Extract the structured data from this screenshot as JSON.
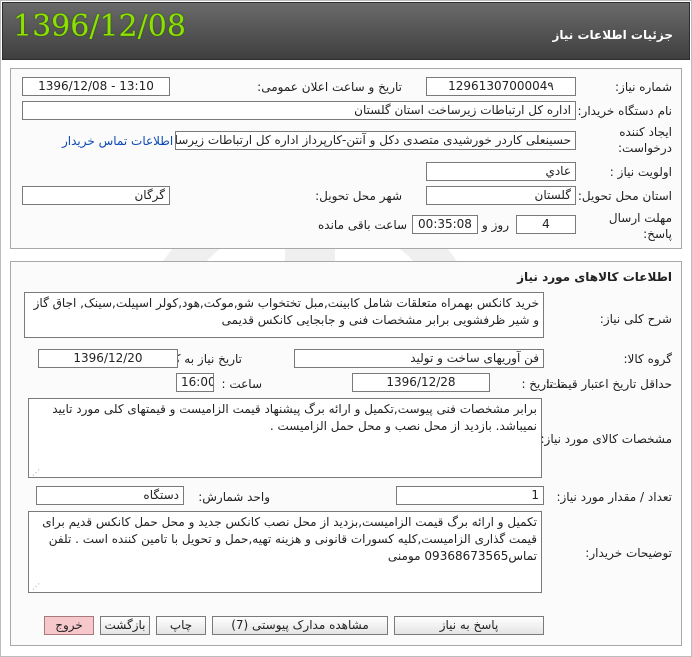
{
  "header": {
    "date": "1396/12/08",
    "title": "جزئیات اطلاعات نیاز"
  },
  "info": {
    "need_number_label": "شماره نیاز:",
    "need_number": "1296130700004۹",
    "announce_label": "تاریخ و ساعت اعلان عمومی:",
    "announce_value": "1396/12/08 - 13:10",
    "buyer_label": "نام دستگاه خریدار:",
    "buyer_value": "اداره کل ارتباطات زیرساخت استان گلستان",
    "creator_label": "ایجاد کننده درخواست:",
    "creator_value": "حسینعلی کاردر خورشیدی متصدی دکل و آنتن-کارپرداز اداره کل ارتباطات زیرساخ",
    "contact_link": "اطلاعات تماس خریدار",
    "priority_label": "اولویت نیاز :",
    "priority_value": "عادي",
    "province_label": "استان محل تحویل:",
    "province_value": "گلستان",
    "city_label": "شهر محل تحویل:",
    "city_value": "گرگان",
    "deadline_label": "مهلت ارسال پاسخ:",
    "deadline_days": "4",
    "days_label": "روز و",
    "deadline_time": "00:35:08",
    "remaining_label": "ساعت باقی مانده"
  },
  "goods": {
    "section_title": "اطلاعات کالاهای مورد نیاز",
    "general_desc_label": "شرح کلی نیاز:",
    "general_desc": "خرید کانکس بهمراه متعلقات شامل کابینت,مبل تختخواب شو,موکت,هود,کولر اسپیلت,سینک, اجاق گاز و شیر ظرفشویی برابر مشخصات فنی و جابجایی کانکس قدیمی",
    "group_label": "گروه کالا:",
    "group_value": "فن آوریهای ساخت و تولید",
    "need_date_label": "تاریخ نیاز به کالا:",
    "need_date": "1396/12/20",
    "min_validity_label": "حداقل تاریخ اعتبار قیمت:",
    "to_date_label": "تا تاریخ :",
    "to_date": "1396/12/28",
    "hour_label": "ساعت :",
    "hour_value": "16:00",
    "spec_label": "مشخصات کالای مورد نیاز:",
    "spec_text": "برابر مشخصات فنی پیوست,تکمیل و ارائه برگ پیشنهاد قیمت الزامیست و قیمتهای کلی مورد تایید نمیباشد. بازدید از محل نصب  و محل حمل الزامیست .",
    "qty_label": "تعداد / مقدار مورد نیاز:",
    "qty_value": "1",
    "unit_label": "واحد شمارش:",
    "unit_value": "دستگاه",
    "buyer_notes_label": "توضیحات خریدار:",
    "buyer_notes": "تکمیل و ارائه برگ قیمت الزامیست,بزدید از محل نصب کانکس جدید و محل حمل کانکس قدیم  برای قیمت گذاری الزامیست,کلیه کسورات قانونی و هزینه تهیه,حمل و تحویل با تامین کننده است . تلفن تماس09368673565 مومنی"
  },
  "buttons": {
    "reply": "پاسخ به نیاز",
    "attachments": "مشاهده مدارک پیوستی (7)",
    "print": "چاپ",
    "back": "بازگشت",
    "exit": "خروج"
  }
}
